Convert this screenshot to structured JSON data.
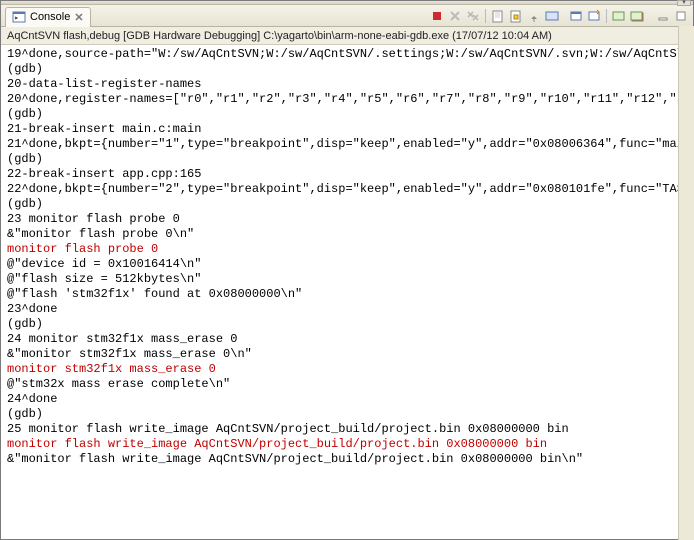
{
  "tab": {
    "label": "Console",
    "close_glyph": "✕"
  },
  "subheader": "AqCntSVN flash,debug [GDB Hardware Debugging] C:\\yagarto\\bin\\arm-none-eabi-gdb.exe (17/07/12 10:04 AM)",
  "icons": {
    "console": "console-icon",
    "stop": "stop-icon",
    "remove": "remove-icon",
    "removeall": "remove-all-icon",
    "clear": "clear-icon",
    "scrolllock": "scroll-lock-icon",
    "pin": "pin-icon",
    "display": "display-icon",
    "open": "open-console-icon",
    "new": "new-console-icon",
    "mon1": "monitor1-icon",
    "mon2": "monitor2-icon",
    "min": "minimize-icon",
    "max": "maximize-icon"
  },
  "console_lines": [
    {
      "t": "19^done,source-path=\"W:/sw/AqCntSVN;W:/sw/AqCntSVN/.settings;W:/sw/AqCntSVN/.svn;W:/sw/AqCntS\\",
      "c": ""
    },
    {
      "t": "(gdb)",
      "c": ""
    },
    {
      "t": "20-data-list-register-names",
      "c": ""
    },
    {
      "t": "20^done,register-names=[\"r0\",\"r1\",\"r2\",\"r3\",\"r4\",\"r5\",\"r6\",\"r7\",\"r8\",\"r9\",\"r10\",\"r11\",\"r12\",\"s",
      "c": ""
    },
    {
      "t": "(gdb)",
      "c": ""
    },
    {
      "t": "21-break-insert main.c:main",
      "c": ""
    },
    {
      "t": "21^done,bkpt={number=\"1\",type=\"breakpoint\",disp=\"keep\",enabled=\"y\",addr=\"0x08006364\",func=\"mai",
      "c": ""
    },
    {
      "t": "(gdb)",
      "c": ""
    },
    {
      "t": "22-break-insert app.cpp:165",
      "c": ""
    },
    {
      "t": "22^done,bkpt={number=\"2\",type=\"breakpoint\",disp=\"keep\",enabled=\"y\",addr=\"0x080101fe\",func=\"TAS",
      "c": ""
    },
    {
      "t": "(gdb)",
      "c": ""
    },
    {
      "t": "23 monitor flash probe 0",
      "c": ""
    },
    {
      "t": "&\"monitor flash probe 0\\n\"",
      "c": ""
    },
    {
      "t": "monitor flash probe 0",
      "c": "err"
    },
    {
      "t": "@\"device id = 0x10016414\\n\"",
      "c": ""
    },
    {
      "t": "@\"flash size = 512kbytes\\n\"",
      "c": ""
    },
    {
      "t": "@\"flash 'stm32f1x' found at 0x08000000\\n\"",
      "c": ""
    },
    {
      "t": "23^done",
      "c": ""
    },
    {
      "t": "(gdb)",
      "c": ""
    },
    {
      "t": "24 monitor stm32f1x mass_erase 0",
      "c": ""
    },
    {
      "t": "&\"monitor stm32f1x mass_erase 0\\n\"",
      "c": ""
    },
    {
      "t": "monitor stm32f1x mass_erase 0",
      "c": "err"
    },
    {
      "t": "@\"stm32x mass erase complete\\n\"",
      "c": ""
    },
    {
      "t": "24^done",
      "c": ""
    },
    {
      "t": "(gdb)",
      "c": ""
    },
    {
      "t": "25 monitor flash write_image AqCntSVN/project_build/project.bin 0x08000000 bin",
      "c": ""
    },
    {
      "t": "monitor flash write_image AqCntSVN/project_build/project.bin 0x08000000 bin",
      "c": "err"
    },
    {
      "t": "&\"monitor flash write_image AqCntSVN/project_build/project.bin 0x08000000 bin\\n\"",
      "c": ""
    }
  ]
}
